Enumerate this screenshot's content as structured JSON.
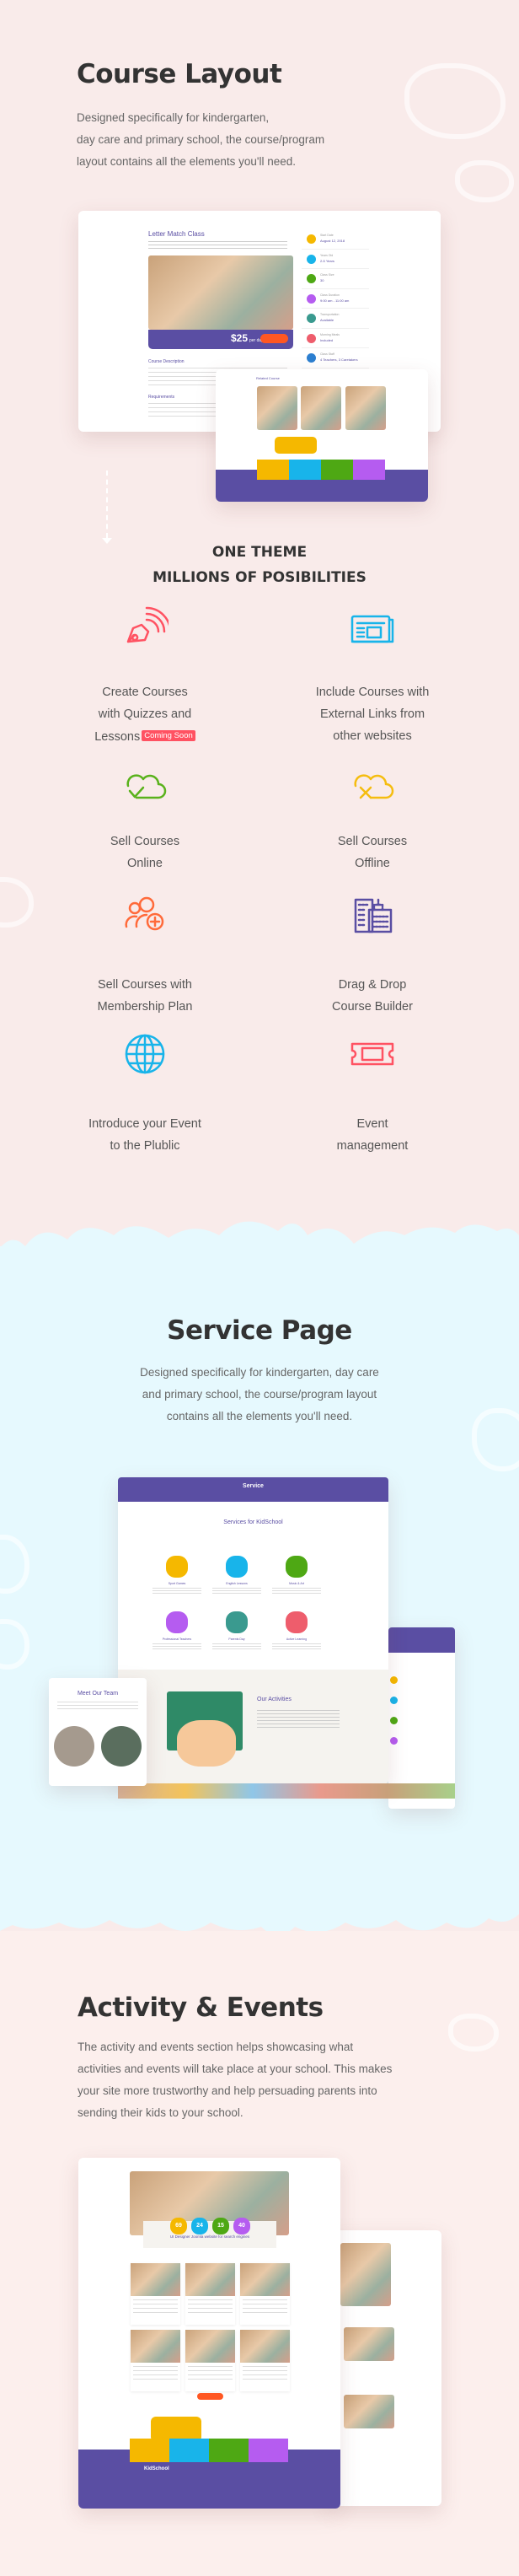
{
  "course_layout": {
    "title": "Course Layout",
    "description_lines": [
      "Designed specifically for kindergarten,",
      "day care and primary school, the course/program",
      "layout contains all the elements you'll need."
    ],
    "mockup": {
      "class_title": "Letter Match Class",
      "price": "$25",
      "price_unit": "per day",
      "course_description_heading": "Course Description",
      "requirements_heading": "Requirements",
      "info": [
        {
          "label": "Start Date",
          "value": "August 12, 2018",
          "color": "#f5b800"
        },
        {
          "label": "Years Old",
          "value": "2-5 Years",
          "color": "#18b4ea"
        },
        {
          "label": "Class Size",
          "value": "30",
          "color": "#4ea814"
        },
        {
          "label": "Class Duration",
          "value": "9:00 am - 11:00 am",
          "color": "#b55cf0"
        },
        {
          "label": "Transportation",
          "value": "Available",
          "color": "#3a9a8f"
        },
        {
          "label": "Morning Meals",
          "value": "Included",
          "color": "#ee5d6c"
        },
        {
          "label": "Class Staff",
          "value": "4 Teachers, 3 Caretakers",
          "color": "#2c7fd0"
        }
      ],
      "related_heading": "Related Course"
    }
  },
  "possibilities": {
    "heading_line1": "ONE THEME",
    "heading_line2": "MILLIONS OF POSIBILITIES",
    "features": [
      {
        "lines": [
          "Create Courses",
          "with Quizzes and",
          "Lessons"
        ],
        "badge": "Coming Soon",
        "icon": "pen-broadcast-icon",
        "color": "#ff5262"
      },
      {
        "lines": [
          "Include Courses with",
          "External Links from",
          "other websites"
        ],
        "icon": "newspaper-icon",
        "color": "#18b4ea"
      },
      {
        "lines": [
          "Sell Courses",
          "Online"
        ],
        "icon": "cloud-check-icon",
        "color": "#5ab21c"
      },
      {
        "lines": [
          "Sell Courses",
          "Offline"
        ],
        "icon": "cloud-x-icon",
        "color": "#f5bd10"
      },
      {
        "lines": [
          "Sell Courses with",
          "Membership Plan"
        ],
        "icon": "users-add-icon",
        "color": "#ff6a3a"
      },
      {
        "lines": [
          "Drag & Drop",
          "Course Builder"
        ],
        "icon": "buildings-icon",
        "color": "#5a4ea3"
      },
      {
        "lines": [
          "Introduce your Event",
          "to the Plublic"
        ],
        "icon": "globe-icon",
        "color": "#18b4ea"
      },
      {
        "lines": [
          "Event",
          "management"
        ],
        "icon": "ticket-icon",
        "color": "#ff5262"
      }
    ]
  },
  "service_page": {
    "title": "Service Page",
    "description_lines": [
      "Designed specifically for kindergarten, day care",
      "and primary school, the course/program layout",
      "contains all the elements you'll need."
    ],
    "mockup": {
      "banner_title": "Service",
      "section_title": "Services for KidSchool",
      "services": [
        {
          "name": "Sport Games",
          "color": "#f5b800"
        },
        {
          "name": "English Lessons",
          "color": "#18b4ea"
        },
        {
          "name": "Music & Art",
          "color": "#4ea814"
        },
        {
          "name": "Professional Teachers",
          "color": "#b55cf0"
        },
        {
          "name": "Parents Day",
          "color": "#3a9a8f"
        },
        {
          "name": "Active Learning",
          "color": "#ee5d6c"
        }
      ],
      "activities_title": "Our Activities",
      "team_title": "Meet Our Team"
    }
  },
  "activity_events": {
    "title": "Activity & Events",
    "description_lines": [
      "The activity and events section helps showcasing what",
      "activities and events will take place at your school. This makes",
      "your site more trustworthy and help persuading parents into",
      "sending their kids to your school."
    ],
    "mockup": {
      "counters": [
        {
          "value": "69",
          "color": "#f5b800"
        },
        {
          "value": "24",
          "color": "#18b4ea"
        },
        {
          "value": "15",
          "color": "#4ea814"
        },
        {
          "value": "40",
          "color": "#b55cf0"
        }
      ],
      "event_title": "UI Designer Joomla website for search engines",
      "footer_logo": "KidSchool"
    }
  },
  "colors": {
    "pink_bg": "#f9ebea",
    "blue_bg": "#e6f9fe",
    "purple": "#5a4ea3",
    "orange": "#ff5722"
  }
}
